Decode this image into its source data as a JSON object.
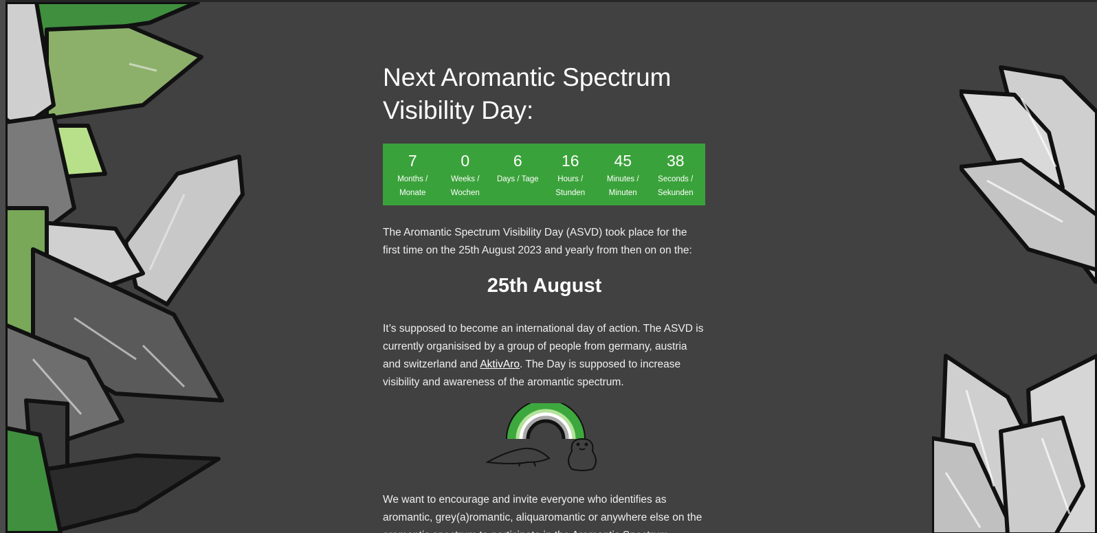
{
  "heading": {
    "title_line1": "Next Aromantic Spectrum",
    "title_line2": "Visibility Day:"
  },
  "countdown": {
    "units": [
      {
        "value": "7",
        "label_line1": "Months /",
        "label_line2": "Monate"
      },
      {
        "value": "0",
        "label_line1": "Weeks /",
        "label_line2": "Wochen"
      },
      {
        "value": "6",
        "label_line1": "Days / Tage",
        "label_line2": ""
      },
      {
        "value": "16",
        "label_line1": "Hours /",
        "label_line2": "Stunden"
      },
      {
        "value": "45",
        "label_line1": "Minutes /",
        "label_line2": "Minuten"
      },
      {
        "value": "38",
        "label_line1": "Seconds /",
        "label_line2": "Sekunden"
      }
    ],
    "color": "#3aa23a"
  },
  "intro": {
    "text": "The Aromantic Spectrum Visibility Day (ASVD) took place for the first time on the 25th August 2023 and yearly from then on on the:"
  },
  "date": {
    "text": "25th August"
  },
  "about": {
    "text_before": "It’s supposed to become an international day of action. The ASVD is currently organisised by a group of people from germany, austria and switzerland and ",
    "link_text": "AktivAro",
    "text_after": ". The Day is supposed to increase visibility and awareness of the aromantic spectrum."
  },
  "invite": {
    "text": "We want to encourage and invite everyone who identifies as aromantic, grey(a)romantic, aliquaromantic or anywhere else on the aromantic spectrum to participate in the Aromantic Spectrum"
  },
  "colors": {
    "background": "#414141",
    "accent_green": "#3aa23a",
    "text": "#ffffff"
  },
  "icons": {
    "rainbow": "aro-flag-rainbow-illustration",
    "crystals": "crystal-decoration"
  }
}
